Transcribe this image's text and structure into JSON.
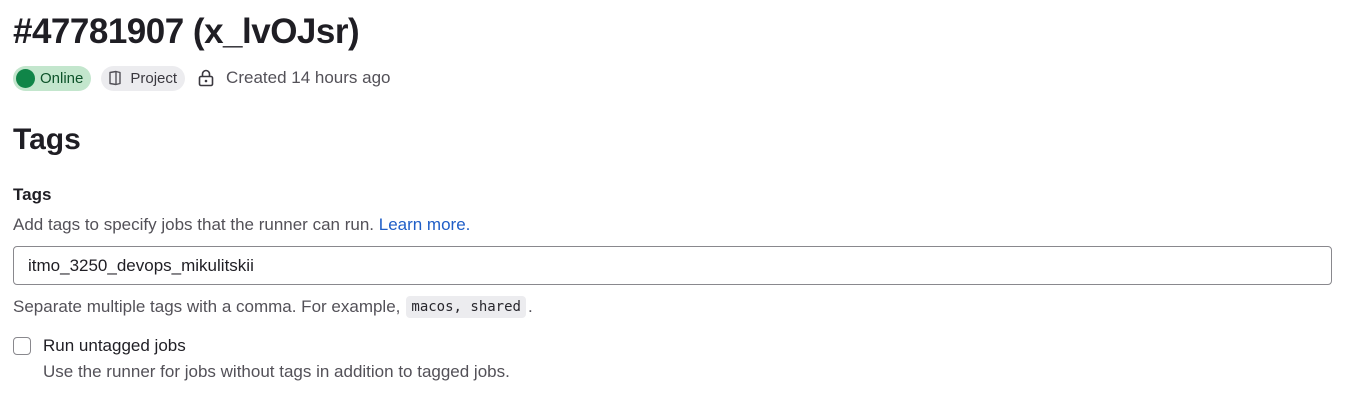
{
  "runner": {
    "title": "#47781907 (x_lvOJsr)",
    "status_badge": "Online",
    "type_badge": "Project",
    "created_text": "Created 14 hours ago",
    "icons": {
      "status": "status-dot-icon",
      "type": "project-icon",
      "lock": "lock-icon"
    },
    "colors": {
      "online_bg": "#c3e6cd",
      "online_dot": "#108548",
      "link": "#1f5ec7"
    }
  },
  "tags_section": {
    "title": "Tags",
    "field_label": "Tags",
    "description": "Add tags to specify jobs that the runner can run.",
    "learn_more": "Learn more.",
    "input_value": "itmo_3250_devops_mikulitskii",
    "help_text_prefix": "Separate multiple tags with a comma. For example,",
    "help_text_example": "macos, shared",
    "help_text_suffix": "."
  },
  "untagged": {
    "label": "Run untagged jobs",
    "help": "Use the runner for jobs without tags in addition to tagged jobs.",
    "checked": false
  }
}
